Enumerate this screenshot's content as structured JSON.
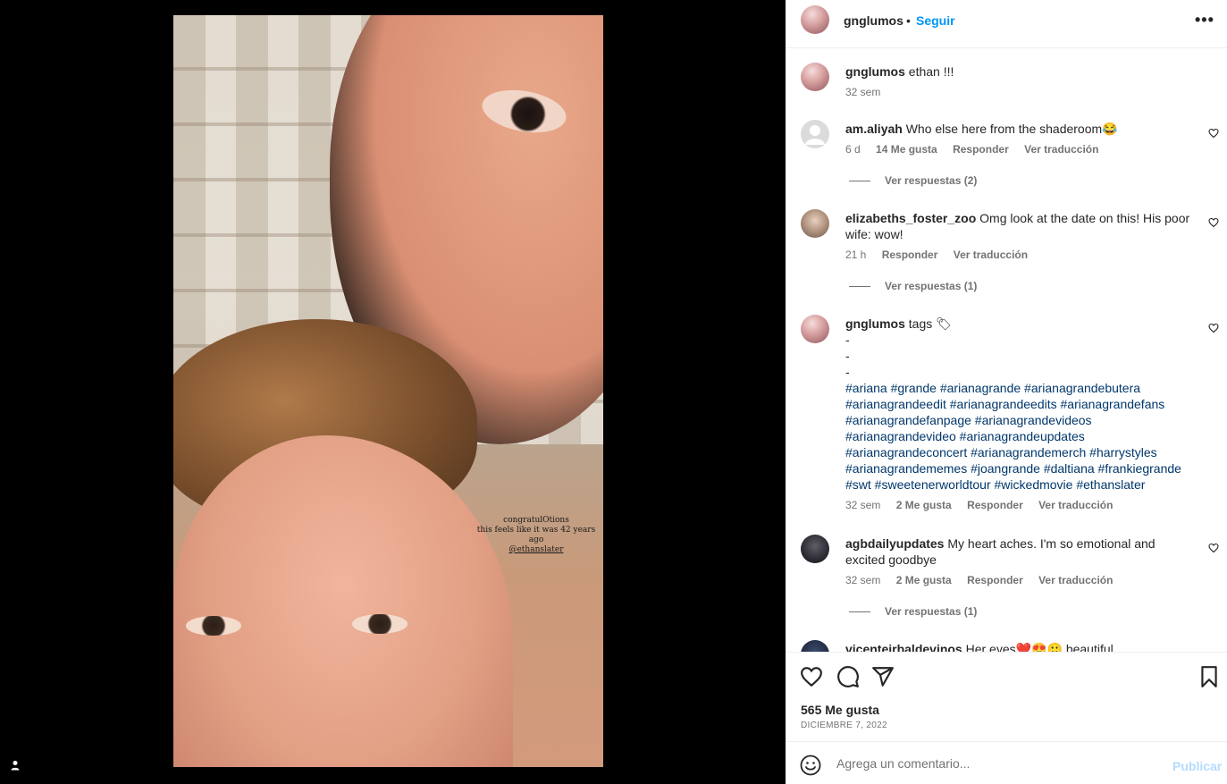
{
  "post": {
    "story_text": {
      "line1": "congratulOtions",
      "line2": "this feels like it was 42 years ago",
      "mention": "@ethanslater"
    }
  },
  "header": {
    "username": "gnglumos",
    "separator": "•",
    "follow_label": "Seguir",
    "more_label": "•••"
  },
  "caption": {
    "username": "gnglumos",
    "text": "ethan !!!",
    "time": "32 sem"
  },
  "comments": [
    {
      "username": "am.aliyah",
      "text": "Who else here from the shaderoom😂",
      "time": "6 d",
      "likes": "14 Me gusta",
      "reply_label": "Responder",
      "translate_label": "Ver traducción",
      "view_replies": "Ver respuestas (2)"
    },
    {
      "username": "elizabeths_foster_zoo",
      "text": "Omg look at the date on this! His poor wife: wow!",
      "time": "21 h",
      "reply_label": "Responder",
      "translate_label": "Ver traducción",
      "view_replies": "Ver respuestas (1)"
    },
    {
      "username": "gnglumos",
      "text": "tags 🏷",
      "dashes": [
        "-",
        "-",
        "-"
      ],
      "hashtags": "#ariana #grande #arianagrande #arianagrandebutera #arianagrandeedit #arianagrandeedits #arianagrandefans #arianagrandefanpage #arianagrandevideos #arianagrandevideo #arianagrandeupdates #arianagrandeconcert #arianagrandemerch #harrystyles #arianagrandememes #joangrande #daltiana #frankiegrande #swt #sweetenerworldtour #wickedmovie #ethanslater",
      "time": "32 sem",
      "likes": "2 Me gusta",
      "reply_label": "Responder",
      "translate_label": "Ver traducción"
    },
    {
      "username": "agbdailyupdates",
      "text": "My heart aches. I'm so emotional and excited goodbye",
      "time": "32 sem",
      "likes": "2 Me gusta",
      "reply_label": "Responder",
      "translate_label": "Ver traducción",
      "view_replies": "Ver respuestas (1)"
    },
    {
      "username": "vicenteirbaldevinos",
      "text": "Her eyes❤️😍🙂 beautiful"
    }
  ],
  "actions": {
    "likes_count": "565 Me gusta",
    "date": "DICIEMBRE 7, 2022"
  },
  "add_comment": {
    "placeholder": "Agrega un comentario...",
    "publish_label": "Publicar"
  },
  "icons": {
    "like": "heart-icon",
    "comment": "comment-icon",
    "share": "send-icon",
    "save": "bookmark-icon",
    "emoji": "emoji-icon",
    "more": "more-icon",
    "tagged_users": "user-icon"
  },
  "colors": {
    "follow_blue": "#0095f6",
    "hashtag_blue": "#00376b",
    "publish_disabled": "#b3dbff",
    "secondary_text": "#737373"
  }
}
